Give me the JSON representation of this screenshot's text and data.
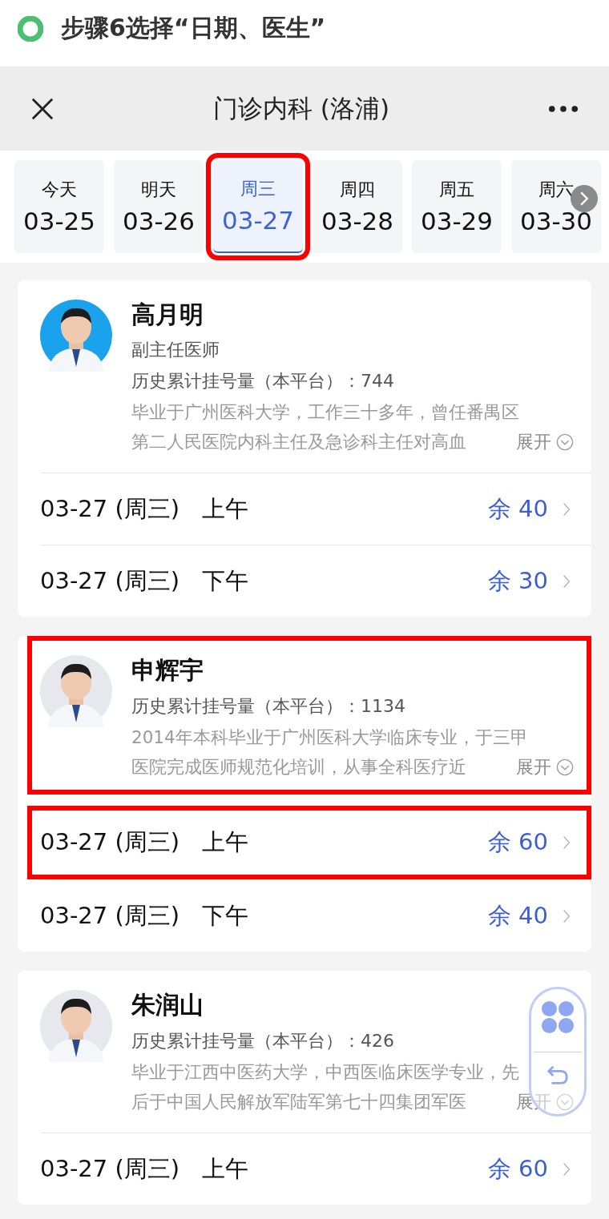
{
  "step_title": "步骤6选择“日期、医生”",
  "nav_bar": {
    "title": "门诊内科 (洛浦)"
  },
  "date_tabs": [
    {
      "weekday": "今天",
      "date": "03-25",
      "selected": false,
      "highlighted": false
    },
    {
      "weekday": "明天",
      "date": "03-26",
      "selected": false,
      "highlighted": false
    },
    {
      "weekday": "周三",
      "date": "03-27",
      "selected": true,
      "highlighted": true
    },
    {
      "weekday": "周四",
      "date": "03-28",
      "selected": false,
      "highlighted": false
    },
    {
      "weekday": "周五",
      "date": "03-29",
      "selected": false,
      "highlighted": false
    },
    {
      "weekday": "周六",
      "date": "03-30",
      "selected": false,
      "highlighted": false
    }
  ],
  "doctors": [
    {
      "name": "高月明",
      "title": "副主任医师",
      "count": "历史累计挂号量（本平台）：744",
      "bio": [
        "毕业于广州医科大学，工作三十多年，曾任番禺区",
        "第二人民医院内科主任及急诊科主任对高血"
      ],
      "expand": "展开",
      "highlighted": false,
      "slots": [
        {
          "date": "03-27 (周三)",
          "period": "上午",
          "remaining": "余 40",
          "highlighted": false
        },
        {
          "date": "03-27 (周三)",
          "period": "下午",
          "remaining": "余 30",
          "highlighted": false
        }
      ]
    },
    {
      "name": "申辉宇",
      "count": "历史累计挂号量（本平台）：1134",
      "bio": [
        "2014年本科毕业于广州医科大学临床专业，于三甲",
        "医院完成医师规范化培训，从事全科医疗近"
      ],
      "expand": "展开",
      "highlighted": true,
      "slots": [
        {
          "date": "03-27 (周三)",
          "period": "上午",
          "remaining": "余 60",
          "highlighted": true
        },
        {
          "date": "03-27 (周三)",
          "period": "下午",
          "remaining": "余 40",
          "highlighted": false
        }
      ]
    },
    {
      "name": "朱润山",
      "count": "历史累计挂号量（本平台）：426",
      "bio": [
        "毕业于江西中医药大学，中西医临床医学专业，先",
        "后于中国人民解放军陆军第七十四集团军医"
      ],
      "expand": "展开",
      "highlighted": false,
      "slots": [
        {
          "date": "03-27 (周三)",
          "period": "上午",
          "remaining": "余 60",
          "highlighted": false
        }
      ]
    }
  ]
}
